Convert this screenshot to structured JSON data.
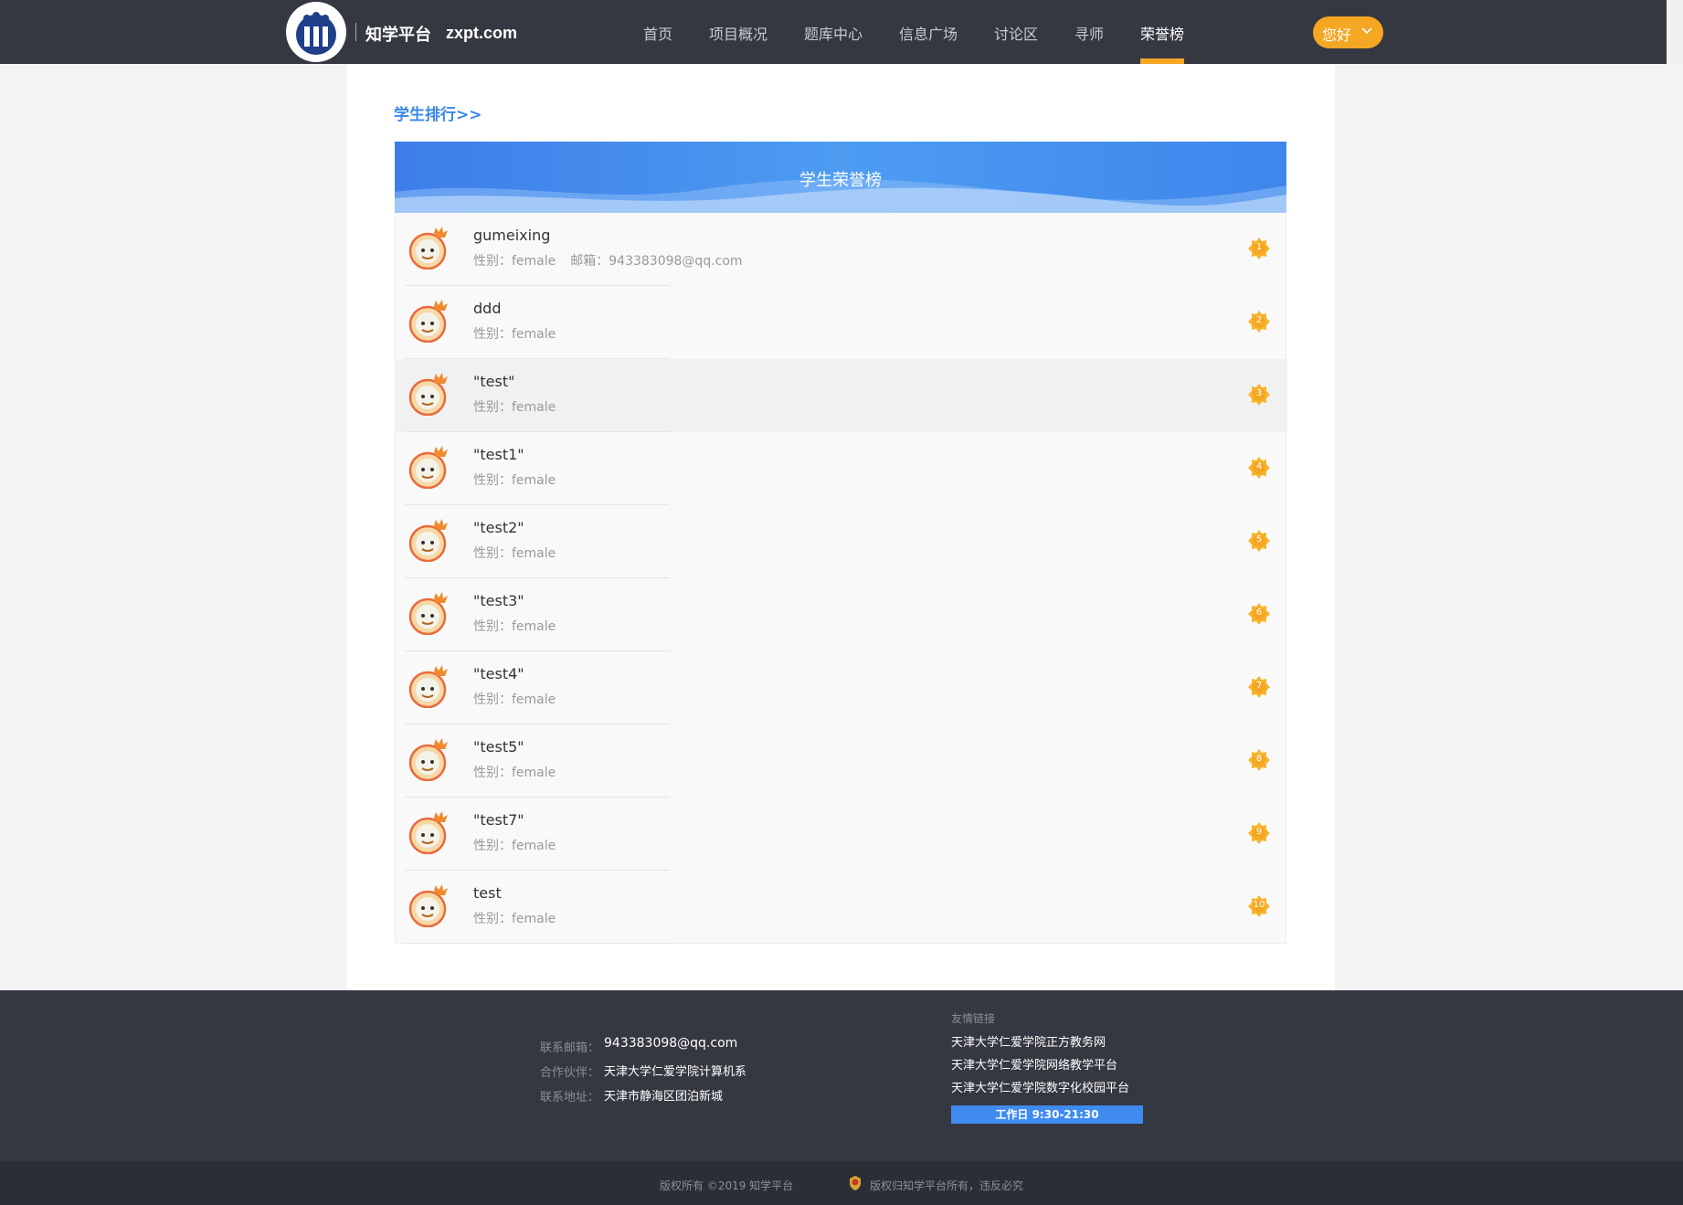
{
  "header": {
    "brand": "知学平台",
    "domain": "zxpt.com",
    "nav": [
      {
        "label": "首页"
      },
      {
        "label": "项目概况"
      },
      {
        "label": "题库中心"
      },
      {
        "label": "信息广场"
      },
      {
        "label": "讨论区"
      },
      {
        "label": "寻师"
      },
      {
        "label": "荣誉榜"
      }
    ],
    "active_nav": "荣誉榜",
    "greeting": "您好"
  },
  "main": {
    "section_title": "学生排行>>",
    "board_title": "学生荣誉榜",
    "students": [
      {
        "rank": "1",
        "name": "gumeixing",
        "gender_label": "性别：",
        "gender": "female",
        "email_label": "邮箱：",
        "email": "943383098@qq.com"
      },
      {
        "rank": "2",
        "name": "ddd",
        "gender_label": "性别：",
        "gender": "female"
      },
      {
        "rank": "3",
        "name": "\"test\"",
        "gender_label": "性别：",
        "gender": "female"
      },
      {
        "rank": "4",
        "name": "\"test1\"",
        "gender_label": "性别：",
        "gender": "female"
      },
      {
        "rank": "5",
        "name": "\"test2\"",
        "gender_label": "性别：",
        "gender": "female"
      },
      {
        "rank": "6",
        "name": "\"test3\"",
        "gender_label": "性别：",
        "gender": "female"
      },
      {
        "rank": "7",
        "name": "\"test4\"",
        "gender_label": "性别：",
        "gender": "female"
      },
      {
        "rank": "8",
        "name": "\"test5\"",
        "gender_label": "性别：",
        "gender": "female"
      },
      {
        "rank": "9",
        "name": "\"test7\"",
        "gender_label": "性别：",
        "gender": "female"
      },
      {
        "rank": "10",
        "name": "test",
        "gender_label": "性别：",
        "gender": "female"
      }
    ]
  },
  "footer": {
    "contact_email_label": "联系邮箱：",
    "contact_email": "943383098@qq.com",
    "partner_label": "合作伙伴：",
    "partner": "天津大学仁爱学院计算机系",
    "address_label": "联系地址：",
    "address": "天津市静海区团泊新城",
    "links_title": "友情链接",
    "links": [
      "天津大学仁爱学院正方教务网",
      "天津大学仁爱学院网络教学平台",
      "天津大学仁爱学院数字化校园平台"
    ],
    "worktime": "工作日 9:30-21:30",
    "copyright": "版权所有 ©2019 知学平台",
    "rights": "版权归知学平台所有，违反必究"
  },
  "colors": {
    "header_bg": "#353841",
    "accent": "#f5a623",
    "primary_blue": "#3a86e8"
  },
  "icons": {
    "logo": "university-logo-icon",
    "avatar": "crowned-avatar-icon",
    "rank": "rank-badge-icon",
    "dropdown": "chevron-down-icon",
    "police": "police-badge-icon"
  }
}
